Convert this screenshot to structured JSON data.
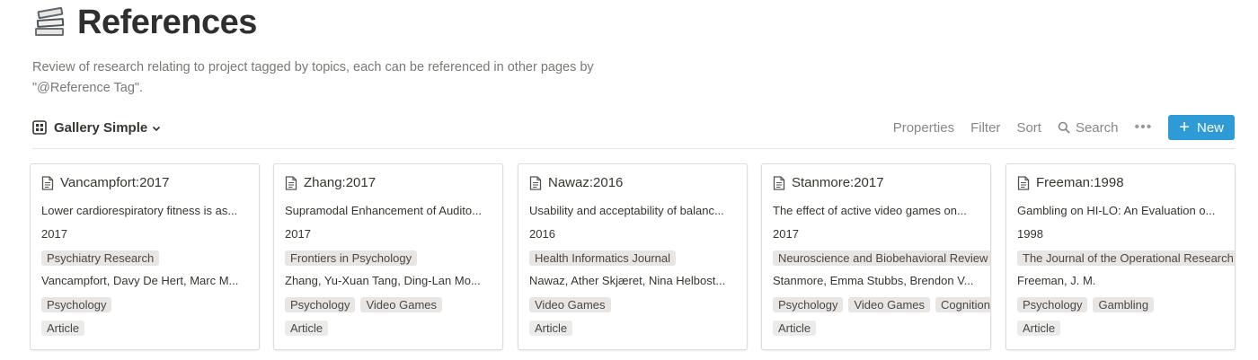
{
  "page": {
    "icon": "books-icon",
    "title": "References",
    "description": "Review of research relating to project tagged by topics, each can be referenced in other pages by \"@Reference Tag\"."
  },
  "toolbar": {
    "view_label": "Gallery Simple",
    "properties_label": "Properties",
    "filter_label": "Filter",
    "sort_label": "Sort",
    "search_label": "Search",
    "more_label": "•••",
    "new_label": "New",
    "new_button_color": "#2e9bd6"
  },
  "cards": [
    {
      "name": "Vancampfort:2017",
      "title": "Lower cardiorespiratory fitness is as...",
      "year": "2017",
      "journal": "Psychiatry Research",
      "authors": "Vancampfort, Davy De Hert, Marc M...",
      "topics": [
        "Psychology"
      ],
      "type": "Article"
    },
    {
      "name": "Zhang:2017",
      "title": "Supramodal Enhancement of Audito...",
      "year": "2017",
      "journal": "Frontiers in Psychology",
      "authors": "Zhang, Yu-Xuan Tang, Ding-Lan Mo...",
      "topics": [
        "Psychology",
        "Video Games"
      ],
      "type": "Article"
    },
    {
      "name": "Nawaz:2016",
      "title": "Usability and acceptability of balanc...",
      "year": "2016",
      "journal": "Health Informatics Journal",
      "authors": "Nawaz, Ather Skjæret, Nina Helbost...",
      "topics": [
        "Video Games"
      ],
      "type": "Article"
    },
    {
      "name": "Stanmore:2017",
      "title": "The effect of active video games on...",
      "year": "2017",
      "journal": "Neuroscience and Biobehavioral Review",
      "authors": "Stanmore, Emma Stubbs, Brendon V...",
      "topics": [
        "Psychology",
        "Video Games",
        "Cognition"
      ],
      "type": "Article"
    },
    {
      "name": "Freeman:1998",
      "title": "Gambling on HI-LO: An Evaluation o...",
      "year": "1998",
      "journal": "The Journal of the Operational Research",
      "authors": "Freeman, J. M.",
      "topics": [
        "Psychology",
        "Gambling"
      ],
      "type": "Article"
    }
  ]
}
